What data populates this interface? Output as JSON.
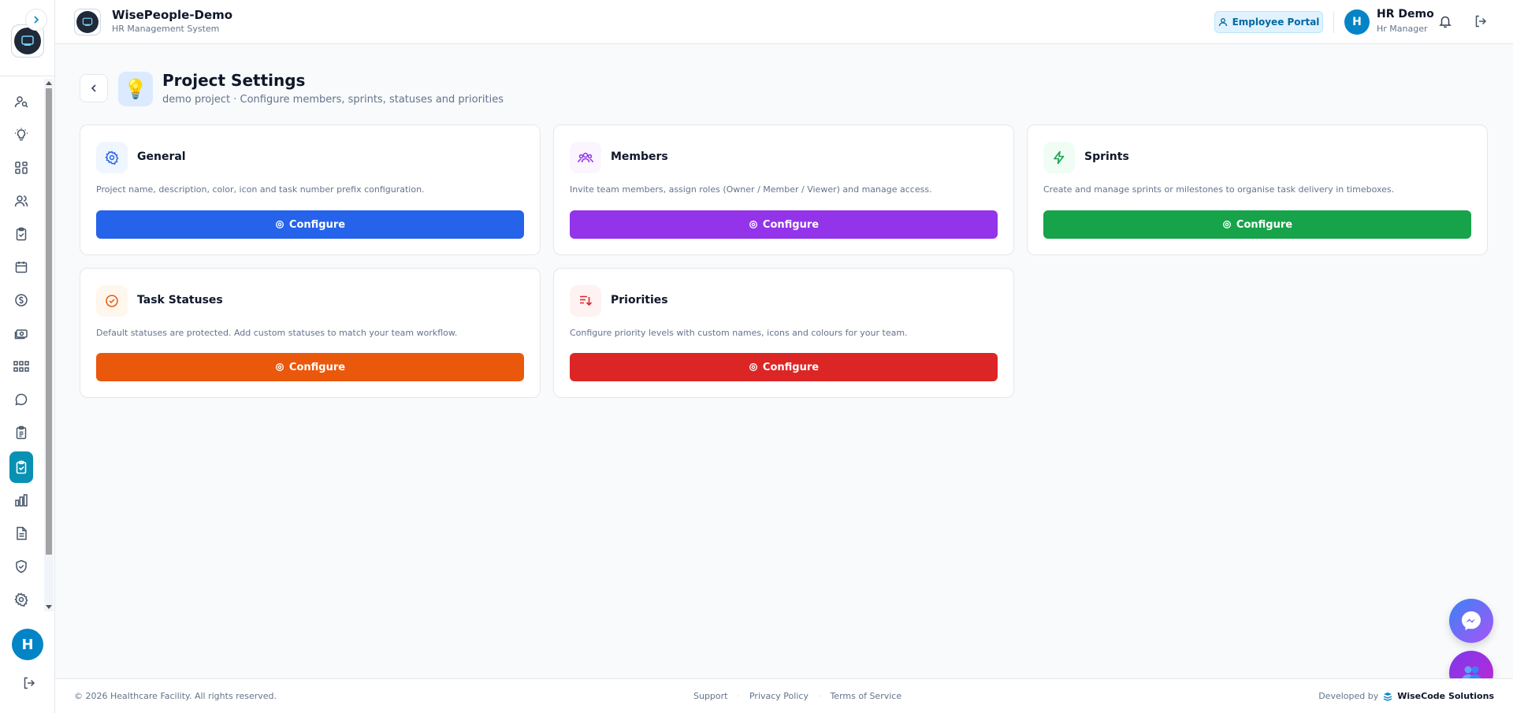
{
  "app": {
    "name": "WisePeople-Demo",
    "subtitle": "HR Management System"
  },
  "header": {
    "portal_button": "Employee Portal",
    "user_initial": "H",
    "user_name": "HR Demo",
    "user_role": "Hr Manager"
  },
  "sidebar": {
    "avatar_initial": "H",
    "items": [
      {
        "icon": "users-search-icon"
      },
      {
        "icon": "lightbulb-icon"
      },
      {
        "icon": "dashboard-grid-icon"
      },
      {
        "icon": "team-icon"
      },
      {
        "icon": "clipboard-check-icon"
      },
      {
        "icon": "calendar-icon"
      },
      {
        "icon": "dollar-icon"
      },
      {
        "icon": "money-icon"
      },
      {
        "icon": "org-chart-icon"
      },
      {
        "icon": "chat-icon"
      },
      {
        "icon": "clipboard-icon"
      },
      {
        "icon": "tasks-icon",
        "active": true
      },
      {
        "icon": "bar-chart-icon"
      },
      {
        "icon": "document-icon"
      },
      {
        "icon": "shield-icon"
      },
      {
        "icon": "settings-icon"
      }
    ]
  },
  "page": {
    "title": "Project Settings",
    "subtitle": "demo project · Configure members, sprints, statuses and priorities",
    "title_icon": "💡"
  },
  "cards": [
    {
      "title": "General",
      "description": "Project name, description, color, icon and task number prefix configuration.",
      "button": "Configure",
      "color": "#2563eb",
      "icon_bg": "#eff6ff",
      "icon": "gear-icon"
    },
    {
      "title": "Members",
      "description": "Invite team members, assign roles (Owner / Member / Viewer) and manage access.",
      "button": "Configure",
      "color": "#9333ea",
      "icon_bg": "#faf5ff",
      "icon": "team-icon"
    },
    {
      "title": "Sprints",
      "description": "Create and manage sprints or milestones to organise task delivery in timeboxes.",
      "button": "Configure",
      "color": "#16a34a",
      "icon_bg": "#f0fdf4",
      "icon": "lightning-icon"
    },
    {
      "title": "Task Statuses",
      "description": "Default statuses are protected. Add custom statuses to match your team workflow.",
      "button": "Configure",
      "color": "#ea580c",
      "icon_bg": "#fff7ed",
      "icon": "check-circle-icon"
    },
    {
      "title": "Priorities",
      "description": "Configure priority levels with custom names, icons and colours for your team.",
      "button": "Configure",
      "color": "#dc2626",
      "icon_bg": "#fef2f2",
      "icon": "sort-priority-icon"
    }
  ],
  "footer": {
    "copyright": "© 2026 Healthcare Facility. All rights reserved.",
    "links": [
      "Support",
      "Privacy Policy",
      "Terms of Service"
    ],
    "separator": "·",
    "developed_by": "Developed by",
    "developer": "WiseCode Solutions"
  }
}
